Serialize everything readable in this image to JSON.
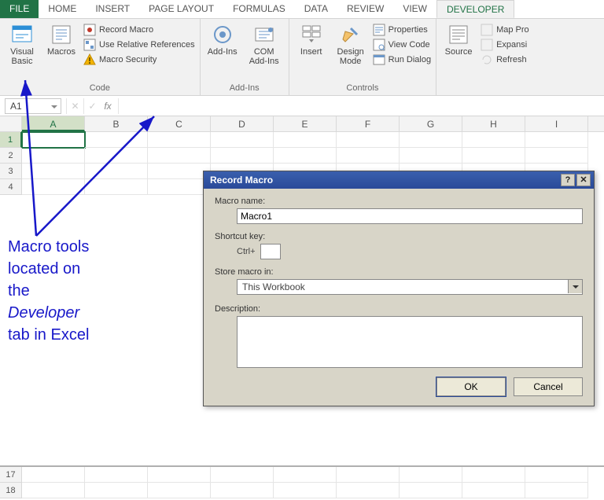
{
  "tabs": {
    "file": "FILE",
    "home": "HOME",
    "insert": "INSERT",
    "pagelayout": "PAGE LAYOUT",
    "formulas": "FORMULAS",
    "data": "DATA",
    "review": "REVIEW",
    "view": "VIEW",
    "developer": "DEVELOPER"
  },
  "ribbon": {
    "code": {
      "label": "Code",
      "visual_basic": "Visual Basic",
      "macros": "Macros",
      "record_macro": "Record Macro",
      "use_relative": "Use Relative References",
      "macro_security": "Macro Security"
    },
    "addins": {
      "label": "Add-Ins",
      "addins": "Add-Ins",
      "com_addins": "COM Add-Ins"
    },
    "controls": {
      "label": "Controls",
      "insert": "Insert",
      "design_mode": "Design Mode",
      "properties": "Properties",
      "view_code": "View Code",
      "run_dialog": "Run Dialog"
    },
    "xml": {
      "source": "Source",
      "map_props": "Map Pro",
      "expansion": "Expansi",
      "refresh": "Refresh"
    }
  },
  "fbar": {
    "namebox": "A1",
    "fx": "fx"
  },
  "sheet": {
    "cols": [
      "A",
      "B",
      "C",
      "D",
      "E",
      "F",
      "G",
      "H",
      "I"
    ],
    "rows_top": [
      "1",
      "2",
      "3",
      "4"
    ],
    "rows_bottom": [
      "17",
      "18"
    ]
  },
  "annotation": {
    "l1": "Macro tools",
    "l2": "located on",
    "l3": "the",
    "l4": "Developer",
    "l5": "tab in Excel"
  },
  "dialog": {
    "title": "Record Macro",
    "help_btn": "?",
    "close_btn": "✕",
    "macro_name_label": "Macro name:",
    "macro_name_value": "Macro1",
    "shortcut_label": "Shortcut key:",
    "shortcut_prefix": "Ctrl+",
    "store_label": "Store macro in:",
    "store_value": "This Workbook",
    "description_label": "Description:",
    "ok": "OK",
    "cancel": "Cancel"
  }
}
